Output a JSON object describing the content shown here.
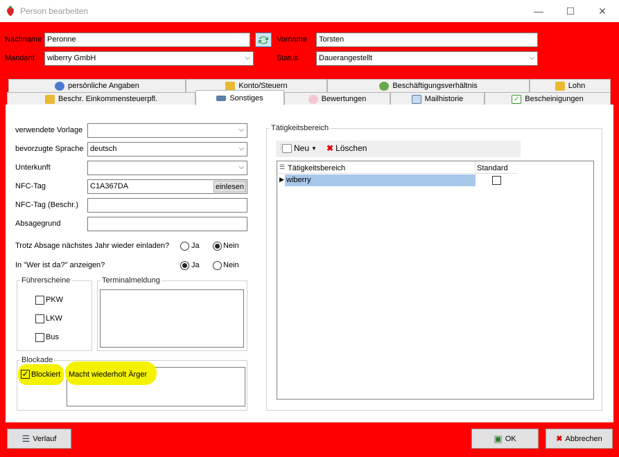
{
  "window": {
    "title": "Person bearbeiten",
    "minimize": "—",
    "maximize": "☐",
    "close": "✕"
  },
  "header": {
    "nachname_label": "Nachname",
    "nachname_value": "Peronne",
    "vorname_label": "Vorname",
    "vorname_value": "Torsten",
    "mandant_label": "Mandant",
    "mandant_value": "wiberry GmbH",
    "status_label": "Status",
    "status_value": "Dauerangestellt"
  },
  "tabs_row1": [
    "persönliche Angaben",
    "Konto/Steuern",
    "Beschäftigungsverhältnis",
    "Lohn"
  ],
  "tabs_row2": [
    "Beschr. Einkommensteuerpfl.",
    "Sonstiges",
    "Bewertungen",
    "Mailhistorie",
    "Bescheinigungen"
  ],
  "form": {
    "vorlage_label": "verwendete Vorlage",
    "vorlage_value": "",
    "sprache_label": "bevorzugte Sprache",
    "sprache_value": "deutsch",
    "unterkunft_label": "Unterkunft",
    "unterkunft_value": "",
    "nfc_label": "NFC-Tag",
    "nfc_value": "C1A367DA",
    "einlesen": "einlesen",
    "nfc_beschr_label": "NFC-Tag (Beschr.)",
    "nfc_beschr_value": "",
    "absagegrund_label": "Absagegrund",
    "absagegrund_value": "",
    "trotz_label": "Trotz Absage nächstes Jahr wieder einladen?",
    "ja": "Ja",
    "nein": "Nein",
    "werist_label": "In \"Wer ist da?\" anzeigen?"
  },
  "fuehrerscheine": {
    "title": "Führerscheine",
    "items": [
      "PKW",
      "LKW",
      "Bus"
    ]
  },
  "terminalmeldung": {
    "title": "Terminalmeldung",
    "value": ""
  },
  "blockade": {
    "title": "Blockade",
    "checkbox": "Blockiert",
    "reason": "Macht wiederholt Ärger"
  },
  "taetigkeit": {
    "title": "Tätigkeitsbereich",
    "new": "Neu",
    "delete": "Löschen",
    "col1": "Tätigkeitsbereich",
    "col2": "Standard",
    "rows": [
      {
        "name": "wiberry"
      }
    ]
  },
  "footer": {
    "verlauf": "Verlauf",
    "ok": "OK",
    "abbrechen": "Abbrechen"
  }
}
